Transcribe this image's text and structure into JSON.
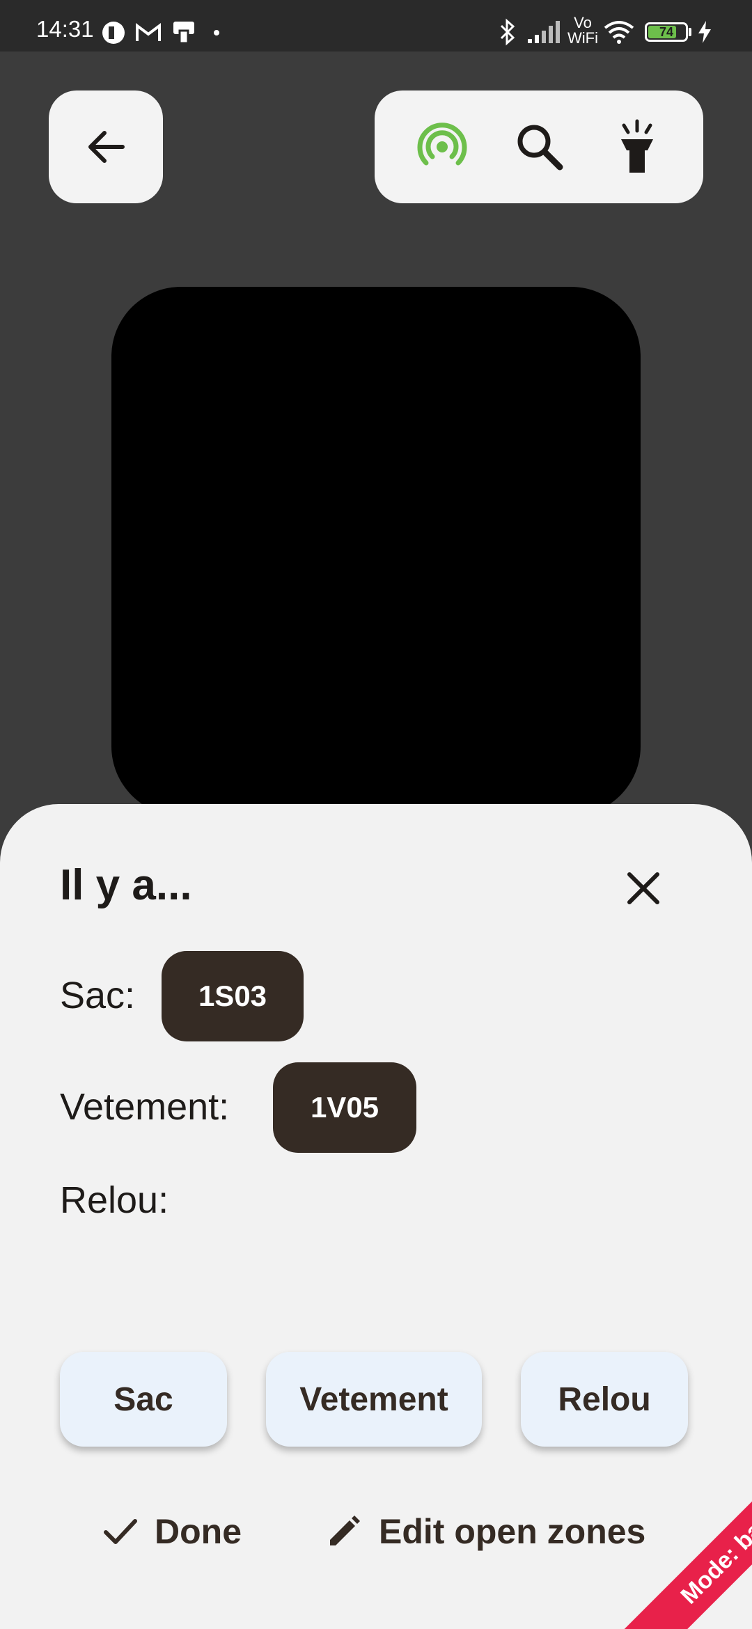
{
  "status_bar": {
    "time": "14:31",
    "battery_level": "74",
    "network_label": "Vo WiFi",
    "icons": [
      "app-icon",
      "gmail-icon",
      "notification-icon",
      "dot-icon",
      "bluetooth-icon",
      "signal-icon",
      "vowifi-icon",
      "wifi-icon",
      "battery-icon",
      "charging-icon"
    ]
  },
  "top_bar": {
    "icons": [
      "back-arrow-icon",
      "nfc-signal-icon",
      "search-icon",
      "flashlight-icon"
    ],
    "accent_color": "#6dbf4b"
  },
  "sheet": {
    "title": "Il y a...",
    "rows": [
      {
        "label": "Sac:",
        "chip": "1S03"
      },
      {
        "label": "Vetement:",
        "chip": "1V05"
      },
      {
        "label": "Relou:",
        "chip": ""
      }
    ],
    "buttons": [
      "Sac",
      "Vetement",
      "Relou"
    ],
    "actions": {
      "done": "Done",
      "edit": "Edit open zones"
    }
  },
  "mode_ribbon": {
    "text": "Mode: bal",
    "color": "#e8214a"
  }
}
